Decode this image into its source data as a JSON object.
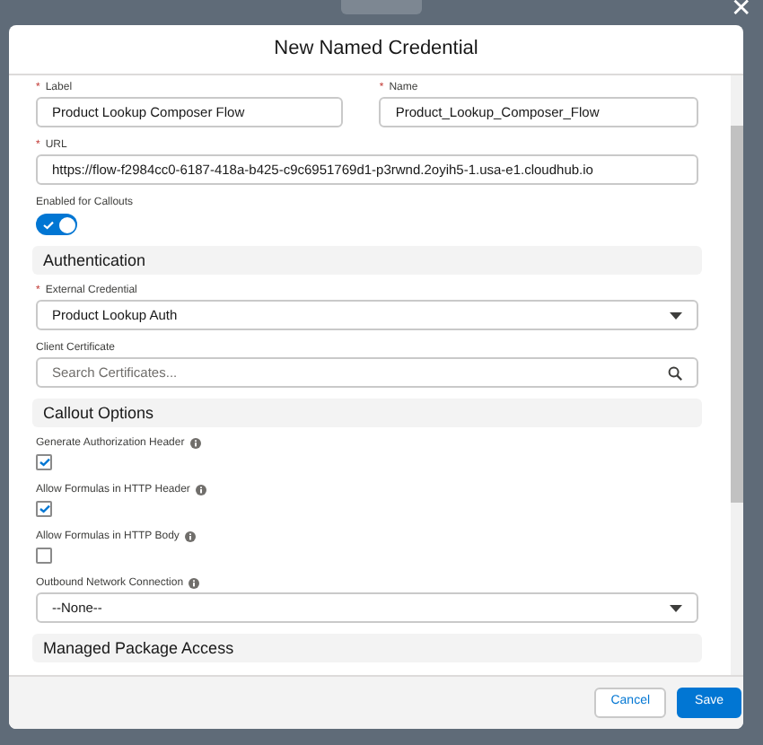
{
  "modal": {
    "title": "New Named Credential",
    "close": "✕"
  },
  "rows": [
    {
      "kind": "pair",
      "fields": [
        {
          "label": "Label",
          "required_mark": "*",
          "value": "Product Lookup Composer Flow"
        },
        {
          "label": "Name",
          "required_mark": "*",
          "value": "Product_Lookup_Composer_Flow"
        }
      ]
    },
    {
      "kind": "text",
      "label": "URL",
      "required_mark": "*",
      "value": "https://flow-f2984cc0-6187-418a-b425-c9c6951769d1-p3rwnd.2oyih5-1.usa-e1.cloudhub.io"
    },
    {
      "kind": "toggle",
      "label": "Enabled for Callouts",
      "on": true
    },
    {
      "kind": "section",
      "label": "Authentication"
    },
    {
      "kind": "select",
      "label": "External Credential",
      "required_mark": "*",
      "value": "Product Lookup Auth"
    },
    {
      "kind": "lookup",
      "label": "Client Certificate",
      "placeholder": "Search Certificates..."
    },
    {
      "kind": "section",
      "label": "Callout Options"
    },
    {
      "kind": "checkbox",
      "label": "Generate Authorization Header",
      "info": true,
      "checked": true
    },
    {
      "kind": "checkbox",
      "label": "Allow Formulas in HTTP Header",
      "info": true,
      "checked": true
    },
    {
      "kind": "checkbox",
      "label": "Allow Formulas in HTTP Body",
      "info": true,
      "checked": false
    },
    {
      "kind": "select",
      "label": "Outbound Network Connection",
      "info": true,
      "value": "--None--"
    },
    {
      "kind": "section",
      "label": "Managed Package Access"
    }
  ],
  "buttons": [
    {
      "label": "Cancel",
      "kind": "neutral"
    },
    {
      "label": "Save",
      "kind": "brand"
    }
  ]
}
